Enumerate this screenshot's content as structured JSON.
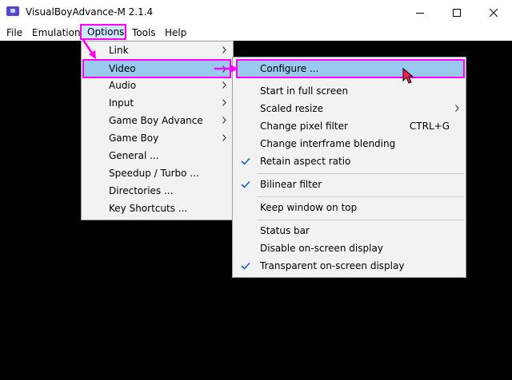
{
  "window": {
    "title": "VisualBoyAdvance-M 2.1.4",
    "icon": "gameboy-advance-icon"
  },
  "menubar": {
    "items": [
      "File",
      "Emulation",
      "Options",
      "Tools",
      "Help"
    ]
  },
  "options_menu": {
    "items": [
      {
        "label": "Link",
        "submenu": true
      },
      {
        "label": "Video",
        "submenu": true
      },
      {
        "label": "Audio",
        "submenu": true
      },
      {
        "label": "Input",
        "submenu": true
      },
      {
        "label": "Game Boy Advance",
        "submenu": true
      },
      {
        "label": "Game Boy",
        "submenu": true
      },
      {
        "label": "General ...",
        "submenu": false
      },
      {
        "label": "Speedup / Turbo ...",
        "submenu": false
      },
      {
        "label": "Directories ...",
        "submenu": false
      },
      {
        "label": "Key Shortcuts ...",
        "submenu": false
      }
    ]
  },
  "video_menu": {
    "items": [
      {
        "label": "Configure ..."
      },
      {
        "label": "Start in full screen"
      },
      {
        "label": "Scaled resize",
        "submenu": true
      },
      {
        "label": "Change pixel filter",
        "shortcut": "CTRL+G"
      },
      {
        "label": "Change interframe blending"
      },
      {
        "label": "Retain aspect ratio",
        "checked": true
      },
      {
        "label": "Bilinear filter",
        "checked": true
      },
      {
        "label": "Keep window on top"
      },
      {
        "label": "Status bar"
      },
      {
        "label": "Disable on-screen display"
      },
      {
        "label": "Transparent on-screen display",
        "checked": true
      }
    ]
  },
  "colors": {
    "highlight": "#99c9ef",
    "annotation": "#ff00ff",
    "menu_bg": "#f2f2f2"
  }
}
